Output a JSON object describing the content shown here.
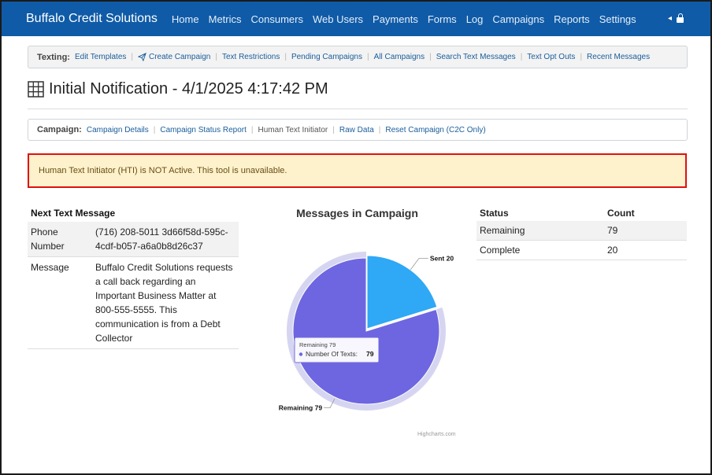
{
  "navbar": {
    "brand": "Buffalo Credit Solutions",
    "items": [
      "Home",
      "Metrics",
      "Consumers",
      "Web Users",
      "Payments",
      "Forms",
      "Log",
      "Campaigns",
      "Reports",
      "Settings"
    ],
    "right_arrow": "◂"
  },
  "texting_bar": {
    "label": "Texting:",
    "links": [
      "Edit Templates",
      "Create Campaign",
      "Text Restrictions",
      "Pending Campaigns",
      "All Campaigns",
      "Search Text Messages",
      "Text Opt Outs",
      "Recent Messages"
    ]
  },
  "page": {
    "title": "Initial Notification - 4/1/2025 4:17:42 PM"
  },
  "campaign_bar": {
    "label": "Campaign:",
    "links": [
      "Campaign Details",
      "Campaign Status Report",
      "Human Text Initiator",
      "Raw Data",
      "Reset Campaign (C2C Only)"
    ]
  },
  "alert": {
    "text": "Human Text Initiator (HTI) is NOT Active. This tool is unavailable."
  },
  "next_message": {
    "header": "Next Text Message",
    "rows": [
      {
        "key": "Phone Number",
        "value": "(716) 208-5011 3d66f58d-595c-4cdf-b057-a6a0b8d26c37"
      },
      {
        "key": "Message",
        "value": "Buffalo Credit Solutions requests a call back regarding an Important Business Matter at 800-555-5555. This communication is from a Debt Collector"
      }
    ]
  },
  "chart_data": {
    "type": "pie",
    "title": "Messages in Campaign",
    "slices": [
      {
        "name": "Sent",
        "value": 20,
        "color": "#2fa8f5"
      },
      {
        "name": "Remaining",
        "value": 79,
        "color": "#6e66e0"
      }
    ],
    "data_labels": [
      "Sent 20",
      "Remaining 79"
    ],
    "tooltip": {
      "title": "Remaining 79",
      "series": "Number Of Texts:",
      "value": "79"
    },
    "credits": "Highcharts.com"
  },
  "status_table": {
    "headers": [
      "Status",
      "Count"
    ],
    "rows": [
      {
        "status": "Remaining",
        "count": "79"
      },
      {
        "status": "Complete",
        "count": "20"
      }
    ]
  },
  "colors": {
    "navbar": "#0f5ba7",
    "alert_bg": "#fdf2cc",
    "alert_border": "#e01010",
    "link": "#1a5d9b"
  }
}
